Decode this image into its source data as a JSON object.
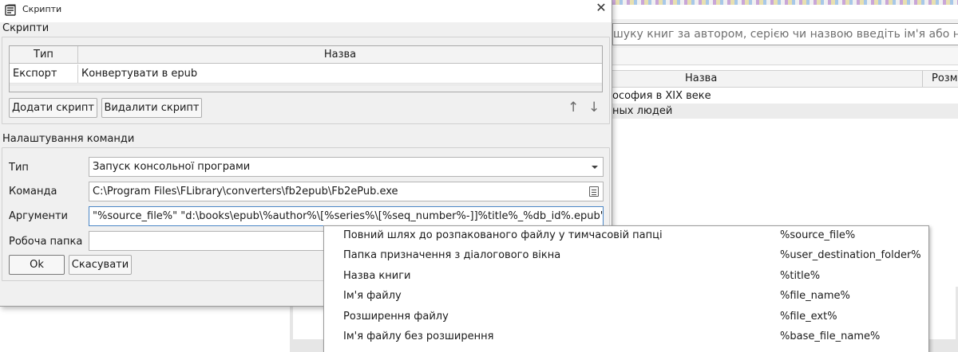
{
  "background": {
    "search_placeholder": "шуку книг за автором, серією чи назвою введіть ім'я або назву т",
    "books_table": {
      "col_name": "Назва",
      "col_size": "Розм"
    },
    "books": [
      "ософия в XIX веке",
      "ных людей"
    ]
  },
  "dialog": {
    "title": "Скрипти",
    "scripts_group": {
      "title": "Скрипти",
      "columns": [
        "Тип",
        "Назва"
      ],
      "rows": [
        {
          "type": "Експорт",
          "name": "Конвертувати в epub"
        }
      ],
      "add_button": "Додати скрипт",
      "delete_button": "Видалити скрипт",
      "move_up_icon": "↑",
      "move_down_icon": "↓"
    },
    "command_group": {
      "title": "Налаштування команди",
      "type_label": "Тип",
      "type_value": "Запуск консольної програми",
      "command_label": "Команда",
      "command_value": "C:\\Program Files\\FLibrary\\converters\\fb2epub\\Fb2ePub.exe",
      "args_label": "Аргументи",
      "args_value": "\"%source_file%\" \"d:\\books\\epub\\%author%\\[%series%\\[%seq_number%-]]%title%_%db_id%.epub\"",
      "workdir_label": "Робоча папка",
      "workdir_value": ""
    },
    "ok_button": "Ok",
    "cancel_button": "Скасувати",
    "close_icon": "✕"
  },
  "popup_menu": {
    "items": [
      {
        "description": "Повний шлях до розпакованого файлу у тимчасовій папці",
        "variable": "%source_file%"
      },
      {
        "description": "Папка призначення з діалогового вікна",
        "variable": "%user_destination_folder%"
      },
      {
        "description": "Назва книги",
        "variable": "%title%"
      },
      {
        "description": "Ім'я файлу",
        "variable": "%file_name%"
      },
      {
        "description": "Розширення файлу",
        "variable": "%file_ext%"
      },
      {
        "description": "Ім'я файлу без розширення",
        "variable": "%base_file_name%"
      }
    ]
  }
}
